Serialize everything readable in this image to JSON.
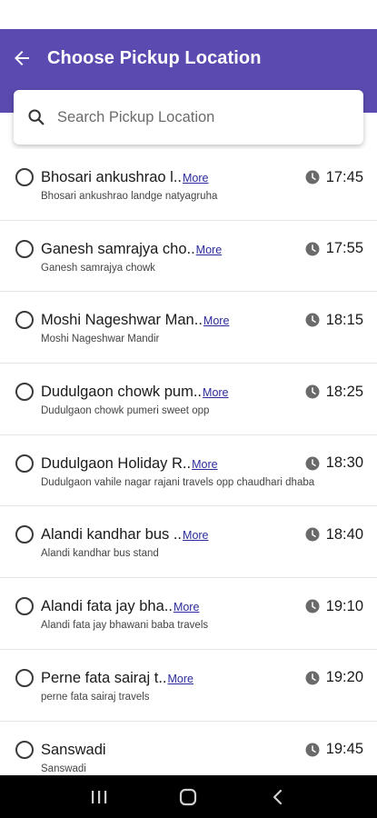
{
  "header": {
    "title": "Choose Pickup Location"
  },
  "search": {
    "placeholder": "Search Pickup Location"
  },
  "colors": {
    "app_bar": "#5b4bb0",
    "link": "#2b2a9a"
  },
  "more_label": "More",
  "locations": [
    {
      "title": "Bhosari ankushrao l..",
      "subtitle": "Bhosari ankushrao landge natyagruha",
      "time": "17:45"
    },
    {
      "title": "Ganesh samrajya cho..",
      "subtitle": "Ganesh samrajya chowk",
      "time": "17:55"
    },
    {
      "title": "Moshi Nageshwar Man..",
      "subtitle": "Moshi Nageshwar Mandir",
      "time": "18:15"
    },
    {
      "title": "Dudulgaon chowk pum..",
      "subtitle": "Dudulgaon chowk pumeri sweet opp",
      "time": "18:25"
    },
    {
      "title": "Dudulgaon Holiday R..",
      "subtitle": "Dudulgaon vahile nagar rajani travels opp chaudhari dhaba",
      "time": "18:30"
    },
    {
      "title": "Alandi kandhar bus ..",
      "subtitle": "Alandi kandhar bus stand",
      "time": "18:40"
    },
    {
      "title": "Alandi fata jay bha..",
      "subtitle": "Alandi fata jay bhawani baba travels",
      "time": "19:10"
    },
    {
      "title": "Perne fata sairaj t..",
      "subtitle": "perne fata sairaj travels",
      "time": "19:20"
    },
    {
      "title": "Sanswadi",
      "subtitle": "Sanswadi",
      "time": "19:45",
      "no_more": true
    }
  ],
  "nav": {
    "recents": "recents-icon",
    "home": "home-icon",
    "back": "back-icon"
  }
}
